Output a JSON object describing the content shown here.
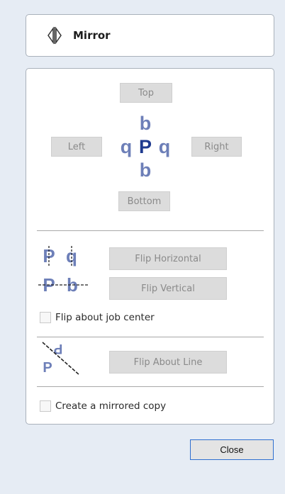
{
  "header": {
    "title": "Mirror",
    "icon": "mirror-icon"
  },
  "direction": {
    "top_label": "Top",
    "left_label": "Left",
    "right_label": "Right",
    "bottom_label": "Bottom",
    "preview_icon": "mirror-preview-icon"
  },
  "flip": {
    "horizontal_label": "Flip Horizontal",
    "vertical_label": "Flip Vertical",
    "horizontal_icon": "flip-horizontal-icon",
    "vertical_icon": "flip-vertical-icon",
    "job_center_label": "Flip about job center",
    "job_center_checked": false
  },
  "line": {
    "label": "Flip About Line",
    "icon": "flip-about-line-icon"
  },
  "copy": {
    "label": "Create a mirrored copy",
    "checked": false
  },
  "footer": {
    "close_label": "Close"
  },
  "colors": {
    "glyph_dark": "#1f3a8f",
    "glyph_light": "#6d7fb8",
    "background": "#e6ecf4",
    "button_disabled": "#dcdcdc",
    "accent_border": "#2f6fd0"
  }
}
